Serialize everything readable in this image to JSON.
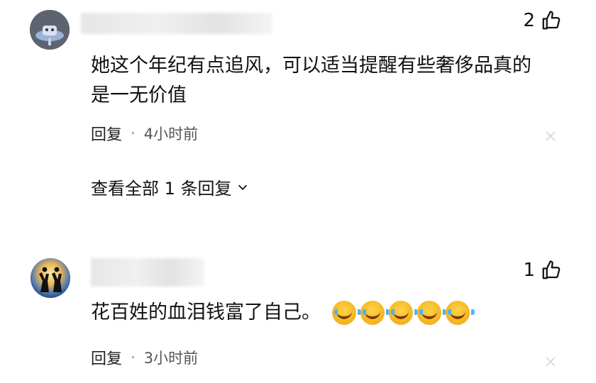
{
  "comments": [
    {
      "likes": "2",
      "text_line1": "她这个年纪有点追风，可以适当提醒有些奢侈品真的",
      "text_line2": "是一无价值",
      "reply_label": "回复",
      "separator": "·",
      "time": "4小时前",
      "view_replies": "查看全部 1 条回复"
    },
    {
      "likes": "1",
      "text": "花百姓的血泪钱富了自己。",
      "reply_label": "回复",
      "separator": "·",
      "time": "3小时前",
      "emoji_count": 5,
      "emoji_icon": "laugh-cry-emoji"
    }
  ],
  "icons": {
    "like": "thumbs-up-icon",
    "dismiss": "close-icon",
    "expand": "chevron-down-icon"
  }
}
